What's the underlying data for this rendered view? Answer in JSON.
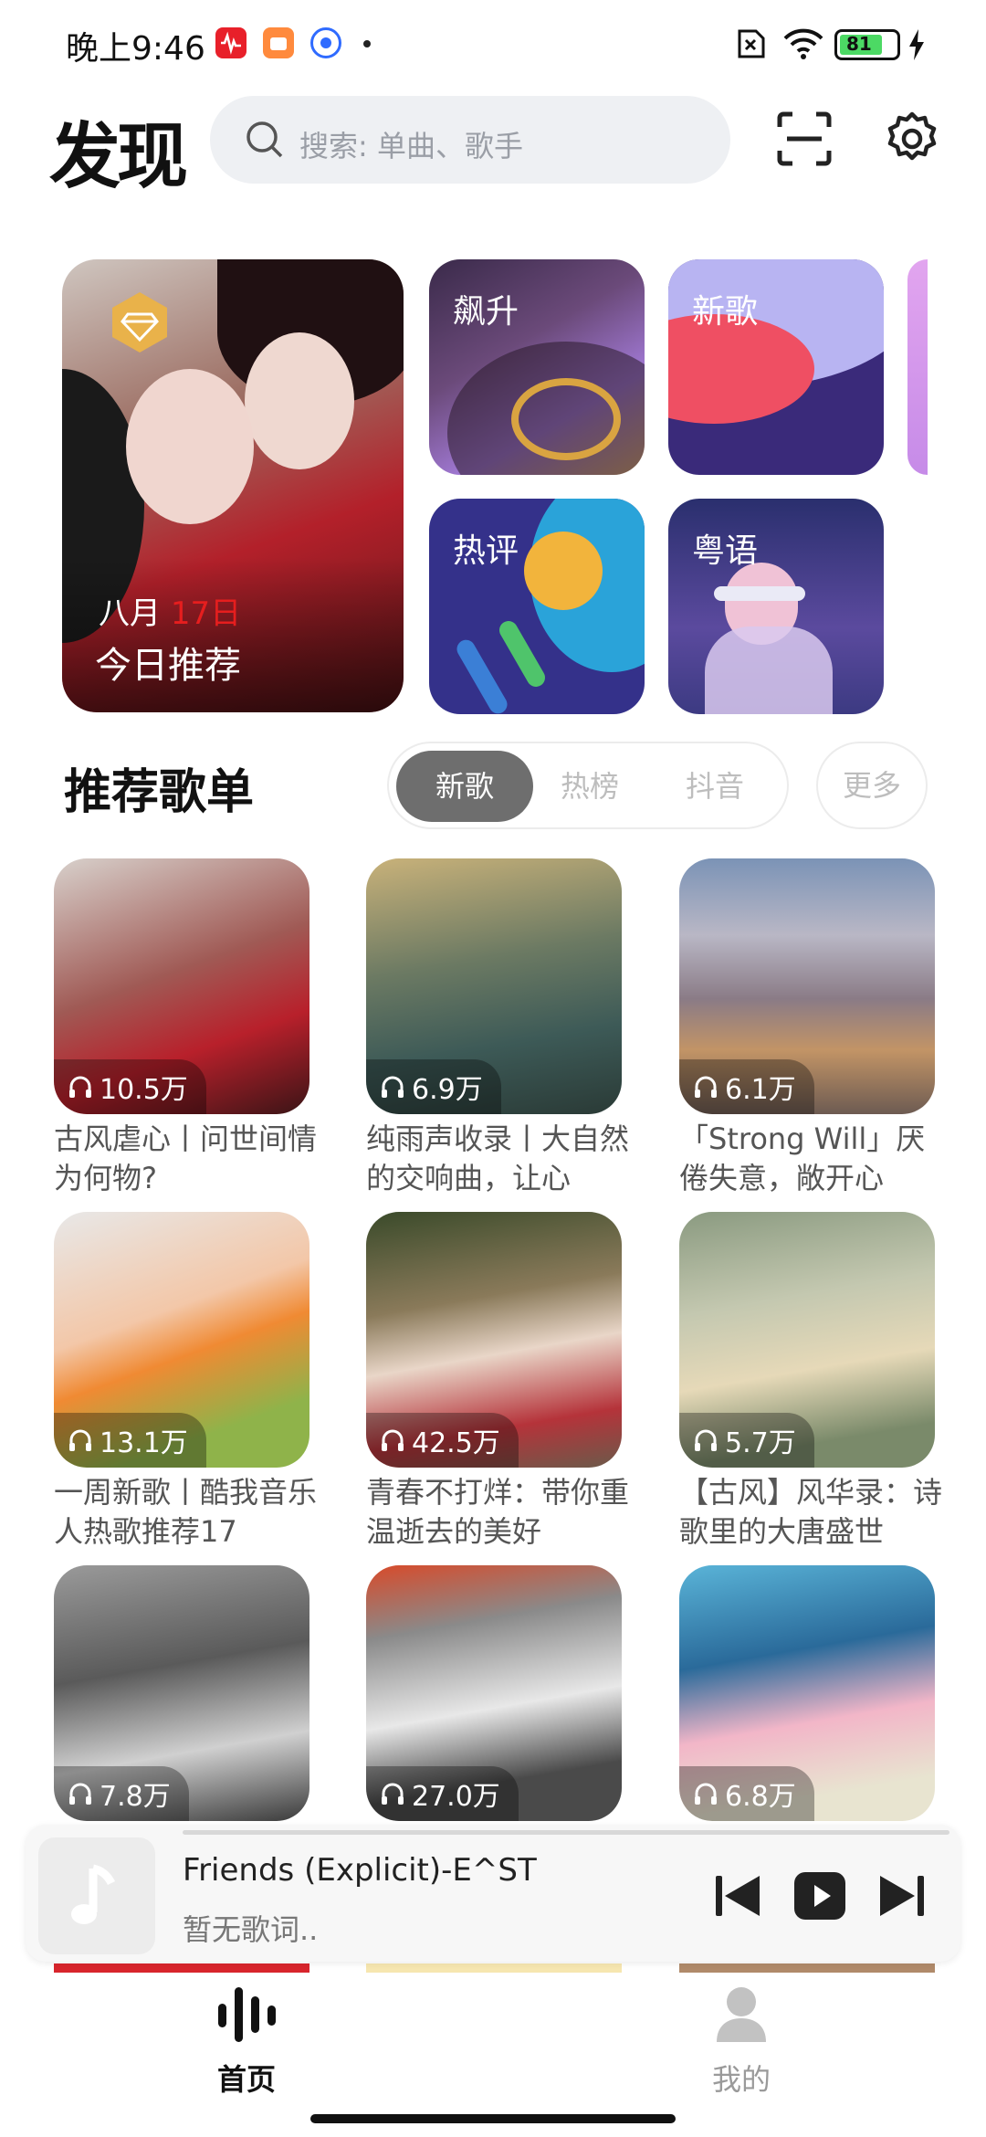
{
  "status_bar": {
    "time": "晚上9:46",
    "battery": "81"
  },
  "header": {
    "title": "发现",
    "search_placeholder": "搜索: 单曲、歌手"
  },
  "banners": {
    "today": {
      "month": "八月",
      "day": "17日",
      "title": "今日推荐"
    },
    "tiles": [
      "飙升",
      "新歌",
      "热评",
      "粤语"
    ]
  },
  "section": {
    "title": "推荐歌单",
    "tabs": [
      "新歌",
      "热榜",
      "抖音"
    ],
    "active_tab": "新歌",
    "more": "更多"
  },
  "playlists": [
    {
      "plays": "10.5万",
      "title": "古风虐心丨问世间情为何物?"
    },
    {
      "plays": "6.9万",
      "title": "纯雨声收录丨大自然的交响曲，让心"
    },
    {
      "plays": "6.1万",
      "title": "「Strong Will」厌倦失意，敞开心"
    },
    {
      "plays": "13.1万",
      "title": "一周新歌丨酷我音乐人热歌推荐17"
    },
    {
      "plays": "42.5万",
      "title": "青春不打烊：带你重温逝去的美好"
    },
    {
      "plays": "5.7万",
      "title": "【古风】风华录：诗歌里的大唐盛世"
    },
    {
      "plays": "7.8万",
      "title": ""
    },
    {
      "plays": "27.0万",
      "title": ""
    },
    {
      "plays": "6.8万",
      "title": ""
    }
  ],
  "player": {
    "song": "Friends (Explicit)-E^ST",
    "lyric": "暂无歌词.."
  },
  "nav": {
    "items": [
      "首页",
      "我的"
    ],
    "active": "首页"
  },
  "colors": {
    "accent_red": "#e61e1e",
    "active_tab": "#6e6e6e",
    "battery_green": "#4cd964"
  }
}
